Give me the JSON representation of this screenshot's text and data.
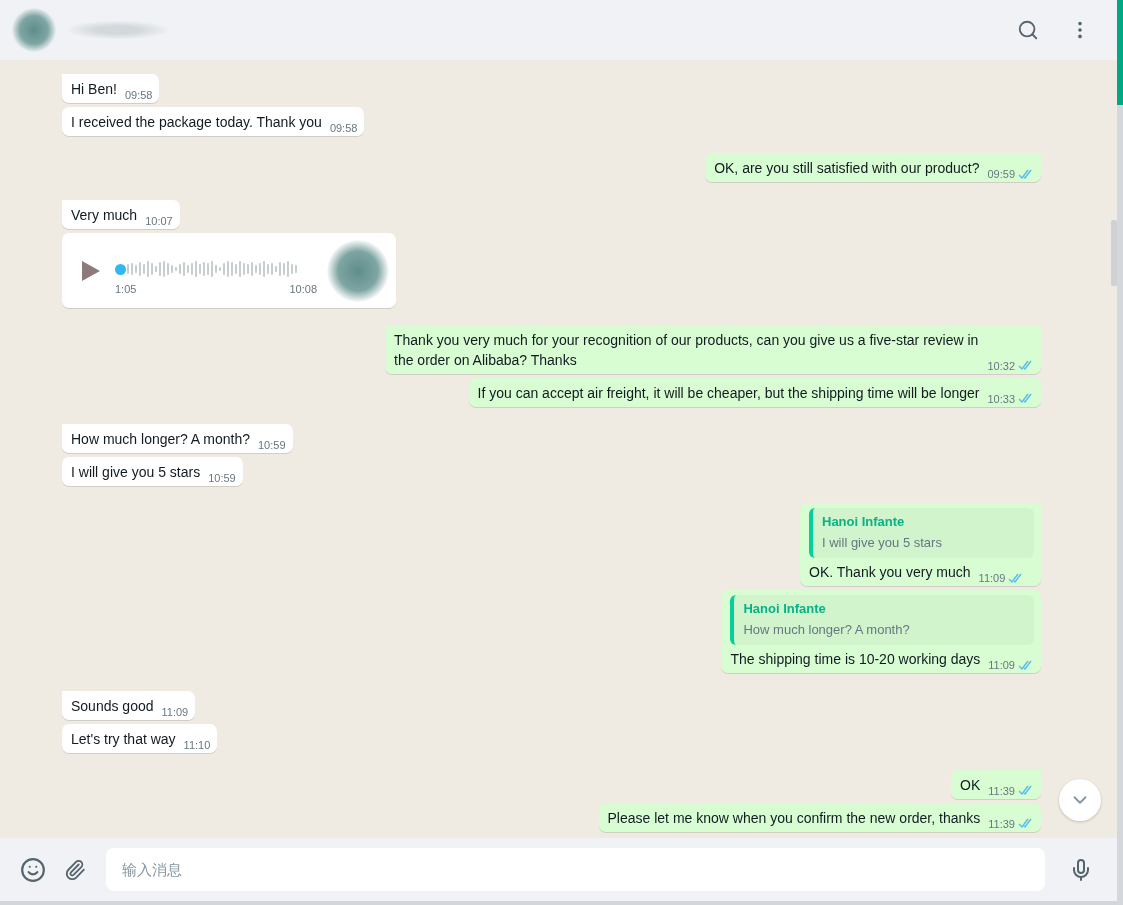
{
  "groups": [
    {
      "outgoing": false,
      "messages": [
        {
          "kind": "text",
          "text": "Hi Ben!",
          "time": "09:58"
        },
        {
          "kind": "text",
          "text": "I received the package today. Thank you",
          "time": "09:58"
        }
      ]
    },
    {
      "outgoing": true,
      "messages": [
        {
          "kind": "text",
          "text": "OK, are you still satisfied with our product?",
          "time": "09:59",
          "read": true
        }
      ]
    },
    {
      "outgoing": false,
      "messages": [
        {
          "kind": "text",
          "text": "Very much",
          "time": "10:07"
        },
        {
          "kind": "voice",
          "duration": "1:05",
          "time": "10:08",
          "level": 0
        }
      ]
    },
    {
      "outgoing": true,
      "messages": [
        {
          "kind": "text",
          "text": "Thank you very much for your recognition of our products, can you give us a five-star review in the order on Alibaba? Thanks",
          "time": "10:32",
          "read": true
        },
        {
          "kind": "text",
          "text": "If you can accept air freight, it will be cheaper, but the shipping time will be longer",
          "time": "10:33",
          "read": true
        }
      ]
    },
    {
      "outgoing": false,
      "messages": [
        {
          "kind": "text",
          "text": "How much longer? A month?",
          "time": "10:59"
        },
        {
          "kind": "text",
          "text": "I will give you 5 stars",
          "time": "10:59"
        }
      ]
    },
    {
      "outgoing": true,
      "messages": [
        {
          "kind": "reply",
          "quote": {
            "author": "Hanoi Infante",
            "text": "I will give you 5 stars"
          },
          "text": "OK. Thank you very much",
          "time": "11:09",
          "read": true
        },
        {
          "kind": "reply",
          "quote": {
            "author": "Hanoi Infante",
            "text": "How much longer? A month?"
          },
          "text": "The shipping time is 10-20 working days",
          "time": "11:09",
          "read": true
        }
      ]
    },
    {
      "outgoing": false,
      "messages": [
        {
          "kind": "text",
          "text": "Sounds good",
          "time": "11:09"
        },
        {
          "kind": "text",
          "text": "Let's try that way",
          "time": "11:10"
        }
      ]
    },
    {
      "outgoing": true,
      "messages": [
        {
          "kind": "text",
          "text": "OK",
          "time": "11:39",
          "read": true
        },
        {
          "kind": "text",
          "text": "Please let me know when you confirm the new order, thanks",
          "time": "11:39",
          "read": true
        }
      ]
    }
  ],
  "composer": {
    "placeholder": "输入消息"
  }
}
